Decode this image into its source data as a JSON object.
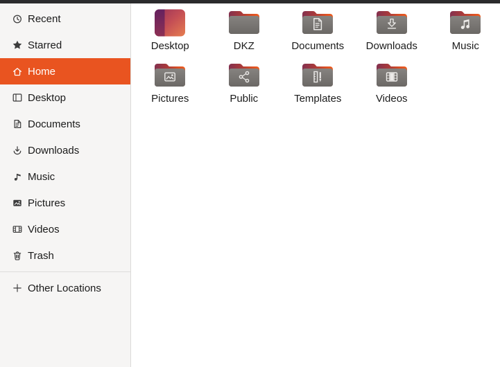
{
  "colors": {
    "accent_orange": "#E95420",
    "sidebar_bg": "#F6F5F4",
    "main_bg": "#FFFFFF",
    "top_edge_bar": "#2B2B2D",
    "folder_front_gray": "#787471",
    "folder_back_maroon": "#84314F",
    "folder_back_orange": "#EE5C1E",
    "text": "#1A1A1A"
  },
  "sidebar": {
    "items": [
      {
        "label": "Recent",
        "icon": "recent-clock-icon",
        "selected": false
      },
      {
        "label": "Starred",
        "icon": "star-icon",
        "selected": false
      },
      {
        "label": "Home",
        "icon": "home-icon",
        "selected": true
      },
      {
        "label": "Desktop",
        "icon": "desktop-pane-icon",
        "selected": false
      },
      {
        "label": "Documents",
        "icon": "document-icon",
        "selected": false
      },
      {
        "label": "Downloads",
        "icon": "download-icon",
        "selected": false
      },
      {
        "label": "Music",
        "icon": "music-note-icon",
        "selected": false
      },
      {
        "label": "Pictures",
        "icon": "picture-icon",
        "selected": false
      },
      {
        "label": "Videos",
        "icon": "film-icon",
        "selected": false
      },
      {
        "label": "Trash",
        "icon": "trash-icon",
        "selected": false
      }
    ],
    "other_locations": {
      "label": "Other Locations",
      "icon": "plus-icon"
    }
  },
  "files": {
    "items": [
      {
        "name": "Desktop",
        "icon": "desktop-gradient-icon"
      },
      {
        "name": "DKZ",
        "icon": "folder-plain-icon"
      },
      {
        "name": "Documents",
        "icon": "folder-documents-icon"
      },
      {
        "name": "Downloads",
        "icon": "folder-downloads-icon"
      },
      {
        "name": "Music",
        "icon": "folder-music-icon"
      },
      {
        "name": "Pictures",
        "icon": "folder-pictures-icon"
      },
      {
        "name": "Public",
        "icon": "folder-public-share-icon"
      },
      {
        "name": "Templates",
        "icon": "folder-templates-icon"
      },
      {
        "name": "Videos",
        "icon": "folder-videos-icon"
      }
    ]
  }
}
